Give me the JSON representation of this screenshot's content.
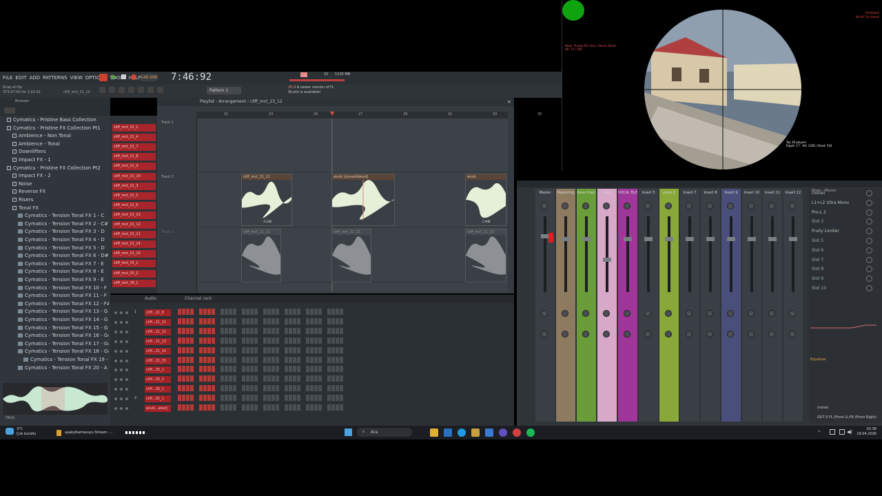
{
  "menu": {
    "items": [
      "FILE",
      "EDIT",
      "ADD",
      "PATTERNS",
      "VIEW",
      "OPTIONS",
      "TOOLS",
      "HELP"
    ]
  },
  "transport": {
    "clock": "7:46:92",
    "bpm": "140.000",
    "memory": "1130 MB",
    "cpu": "22",
    "pattern": "Pattern 1"
  },
  "hint": {
    "line1": "Snap all fip",
    "line2": "373:07:00 for 1:01:91",
    "file": "cliff_mct_21_12"
  },
  "notice": {
    "text": "A newer version of FL Studio is available!",
    "code": "20.9"
  },
  "browser": {
    "title": "Browser",
    "items": [
      {
        "label": "Cymatics - Pristine Bass Collection",
        "type": "folder",
        "indent": 1
      },
      {
        "label": "Cymatics - Pristine FX Collection Pt1",
        "type": "folder",
        "indent": 1
      },
      {
        "label": "Ambience - Non Tonal",
        "type": "folder",
        "indent": 2
      },
      {
        "label": "Ambience - Tonal",
        "type": "folder",
        "indent": 2
      },
      {
        "label": "Downlifters",
        "type": "folder",
        "indent": 2
      },
      {
        "label": "Impact FX - 1",
        "type": "folder",
        "indent": 2
      },
      {
        "label": "Cymatics - Pristine FX Collection Pt2",
        "type": "folder",
        "indent": 1
      },
      {
        "label": "Impact FX - 2",
        "type": "folder",
        "indent": 2
      },
      {
        "label": "Noise",
        "type": "folder",
        "indent": 2
      },
      {
        "label": "Reverse FX",
        "type": "folder",
        "indent": 2
      },
      {
        "label": "Risers",
        "type": "folder",
        "indent": 2
      },
      {
        "label": "Tonal FX",
        "type": "folder",
        "indent": 2
      },
      {
        "label": "Cymatics - Tension Tonal FX 1 - C",
        "type": "file",
        "indent": 3
      },
      {
        "label": "Cymatics - Tension Tonal FX 2 - C#",
        "type": "file",
        "indent": 3
      },
      {
        "label": "Cymatics - Tension Tonal FX 3 - D",
        "type": "file",
        "indent": 3
      },
      {
        "label": "Cymatics - Tension Tonal FX 4 - D",
        "type": "file",
        "indent": 3
      },
      {
        "label": "Cymatics - Tension Tonal FX 5 - D",
        "type": "file",
        "indent": 3
      },
      {
        "label": "Cymatics - Tension Tonal FX 6 - D#",
        "type": "file",
        "indent": 3
      },
      {
        "label": "Cymatics - Tension Tonal FX 7 - E",
        "type": "file",
        "indent": 3
      },
      {
        "label": "Cymatics - Tension Tonal FX 8 - E",
        "type": "file",
        "indent": 3
      },
      {
        "label": "Cymatics - Tension Tonal FX 9 - E",
        "type": "file",
        "indent": 3
      },
      {
        "label": "Cymatics - Tension Tonal FX 10 - F",
        "type": "file",
        "indent": 3
      },
      {
        "label": "Cymatics - Tension Tonal FX 11 - F",
        "type": "file",
        "indent": 3
      },
      {
        "label": "Cymatics - Tension Tonal FX 12 - F#",
        "type": "file",
        "indent": 3
      },
      {
        "label": "Cymatics - Tension Tonal FX 13 - G",
        "type": "file",
        "indent": 3
      },
      {
        "label": "Cymatics - Tension Tonal FX 14 - G",
        "type": "file",
        "indent": 3
      },
      {
        "label": "Cymatics - Tension Tonal FX 15 - G",
        "type": "file",
        "indent": 3
      },
      {
        "label": "Cymatics - Tension Tonal FX 16 - G#",
        "type": "file",
        "indent": 3
      },
      {
        "label": "Cymatics - Tension Tonal FX 17 - G#",
        "type": "file",
        "indent": 3
      },
      {
        "label": "Cymatics - Tension Tonal FX 18 - G#",
        "type": "file",
        "indent": 3
      },
      {
        "label": "Cymatics - Tension Tonal FX 19 - A",
        "type": "file",
        "indent": 4
      },
      {
        "label": "Cymatics - Tension Tonal FX 20 - A",
        "type": "file",
        "indent": 3
      }
    ],
    "tags_label": "TAGS"
  },
  "clips_list": [
    "cliff_mct_21_1",
    "cliff_mct_21_4",
    "cliff_mct_21_7",
    "cliff_mct_21_8",
    "cliff_mct_21_9",
    "cliff_mct_21_10",
    "cliff_mct_21_3",
    "cliff_mct_21_5",
    "cliff_mct_21_6",
    "cliff_mct_21_13",
    "cliff_mct_21_12",
    "cliff_mct_21_11",
    "cliff_mct_21_14",
    "cliff_mct_21_15",
    "cliff_mct_25_1",
    "cliff_mct_25_2",
    "cliff_mct_26_1"
  ],
  "playlist": {
    "title": "Playlist - Arrangement",
    "pattern": "cliff_mct_23_12",
    "ruler": [
      "21",
      "23",
      "25",
      "27",
      "29",
      "31",
      "33",
      "35"
    ],
    "tracks": [
      "Track 1",
      "Track 2",
      "Track 3"
    ],
    "clips": [
      {
        "label": "cliff_mct_21_11",
        "db": "-4.2dB"
      },
      {
        "label": "eksik [consolidated]",
        "db": ""
      },
      {
        "label": "eksik",
        "db": "2.9dB"
      }
    ],
    "ghost_clips": [
      "cliff_mct_21_11",
      "cliff_mct_21_12",
      "cliff_mct_21_13"
    ]
  },
  "channel_rack": {
    "title": "Channel rack",
    "filter": "Audio",
    "channels": [
      {
        "num": "1",
        "name": "cliff...21_8"
      },
      {
        "num": "",
        "name": "cliff...21_11"
      },
      {
        "num": "",
        "name": "cliff...21_12"
      },
      {
        "num": "",
        "name": "cliff...21_13"
      },
      {
        "num": "",
        "name": "cliff...21_14"
      },
      {
        "num": "",
        "name": "cliff...21_15"
      },
      {
        "num": "",
        "name": "cliff...25_1"
      },
      {
        "num": "",
        "name": "cliff...25_2"
      },
      {
        "num": "",
        "name": "cliff...26_1"
      },
      {
        "num": "2",
        "name": "cliff...25_1"
      },
      {
        "num": "",
        "name": "eksik...ated]"
      }
    ]
  },
  "mixer": {
    "title": "Mixer - Master",
    "strips": [
      {
        "name": "Master",
        "color": "#3a3f45"
      },
      {
        "name": "Mastering",
        "color": "#8e7a5e"
      },
      {
        "name": "bass chain",
        "color": "#6a9c3a"
      },
      {
        "name": "kick",
        "color": "#d8a8c8"
      },
      {
        "name": "VOCAL BUS",
        "color": "#a0359a"
      },
      {
        "name": "Insert 5",
        "color": "#3a3f45"
      },
      {
        "name": "vocal 2",
        "color": "#8aa83a"
      },
      {
        "name": "Insert 7",
        "color": "#3a3f45"
      },
      {
        "name": "Insert 8",
        "color": "#3a3f45"
      },
      {
        "name": "Insert 9",
        "color": "#4a4e7a"
      },
      {
        "name": "Insert 10",
        "color": "#3a3f45"
      },
      {
        "name": "Insert 11",
        "color": "#3a3f45"
      },
      {
        "name": "Insert 12",
        "color": "#3a3f45"
      }
    ],
    "slots": [
      "(none)",
      "L1+L2 Ultra Mono",
      "Pro-L 2",
      "Slot 3",
      "Fruity Limiter",
      "Slot 5",
      "Slot 6",
      "Slot 7",
      "Slot 8",
      "Slot 9",
      "Slot 10"
    ],
    "eq_label": "Equalizer",
    "output": "OUT 0 FL (Front Lt,FR (Front Right)",
    "in_label": "(none)"
  },
  "game_hud": {
    "server": "Nash: Private Pro Clan / Server Reset",
    "hp": "HP: 74 / 100",
    "top": "Redekbek",
    "top2": "No.Kill Tec Heads",
    "bottom": "Top 30 players",
    "bottom2": "Ragnt: 17 - Hit: 1200 / Dead: 504"
  },
  "taskbar": {
    "weather_temp": "3°C",
    "weather_desc": "Çok bulutlu",
    "app": "ayakyikamasuyu Stream -...",
    "search": "Ara",
    "time": "02:38",
    "date": "19.04.2026"
  }
}
